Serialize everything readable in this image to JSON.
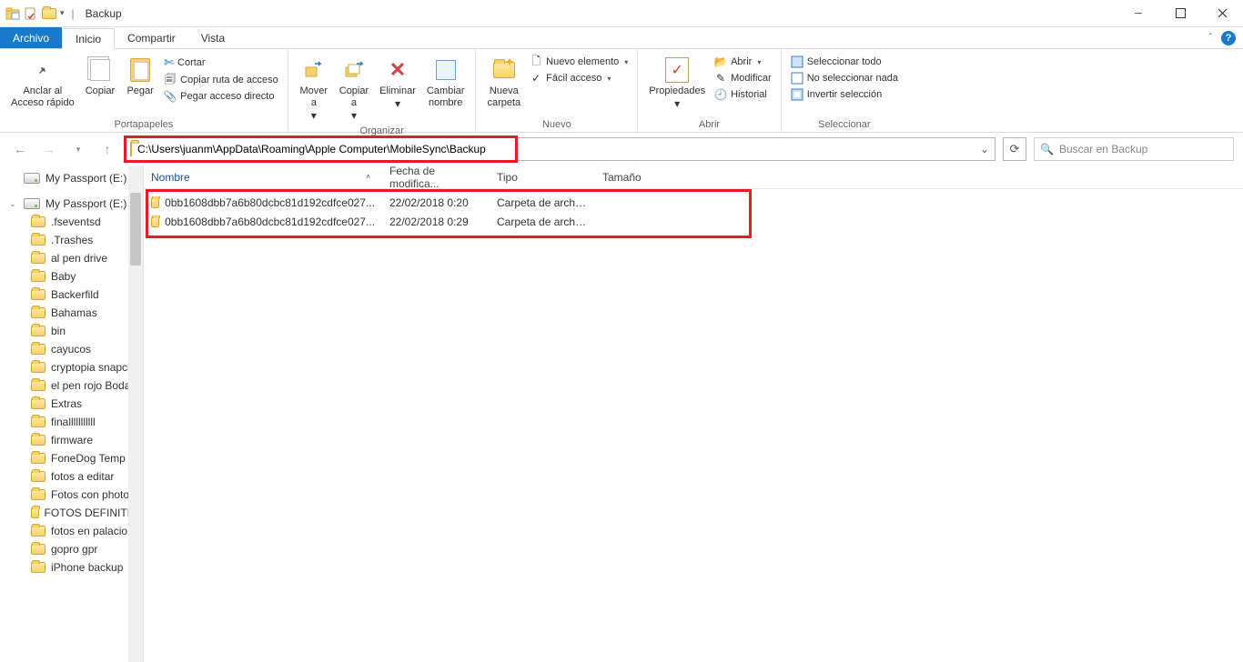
{
  "window": {
    "title": "Backup"
  },
  "tabs": {
    "file": "Archivo",
    "home": "Inicio",
    "share": "Compartir",
    "view": "Vista"
  },
  "ribbon": {
    "clipboard": {
      "pin": "Anclar al\nAcceso rápido",
      "copy": "Copiar",
      "paste": "Pegar",
      "cut": "Cortar",
      "copypath": "Copiar ruta de acceso",
      "pasteshortcut": "Pegar acceso directo",
      "label": "Portapapeles"
    },
    "organize": {
      "moveto": "Mover\na",
      "copyto": "Copiar\na",
      "delete": "Eliminar",
      "rename": "Cambiar\nnombre",
      "label": "Organizar"
    },
    "new": {
      "newfolder": "Nueva\ncarpeta",
      "newitem": "Nuevo elemento",
      "easyaccess": "Fácil acceso",
      "label": "Nuevo"
    },
    "open": {
      "properties": "Propiedades",
      "open": "Abrir",
      "edit": "Modificar",
      "history": "Historial",
      "label": "Abrir"
    },
    "select": {
      "selectall": "Seleccionar todo",
      "selectnone": "No seleccionar nada",
      "invert": "Invertir selección",
      "label": "Seleccionar"
    }
  },
  "address": {
    "path": "C:\\Users\\juanm\\AppData\\Roaming\\Apple Computer\\MobileSync\\Backup"
  },
  "search": {
    "placeholder": "Buscar en Backup"
  },
  "columns": {
    "name": "Nombre",
    "date": "Fecha de modifica...",
    "type": "Tipo",
    "size": "Tamaño"
  },
  "rows": [
    {
      "name": "0bb1608dbb7a6b80dcbc81d192cdfce027...",
      "date": "22/02/2018 0:20",
      "type": "Carpeta de archivos"
    },
    {
      "name": "0bb1608dbb7a6b80dcbc81d192cdfce027...",
      "date": "22/02/2018 0:29",
      "type": "Carpeta de archivos"
    }
  ],
  "sidebar": {
    "drives": [
      "My Passport (E:)",
      "My Passport (E:)"
    ],
    "folders": [
      ".fseventsd",
      ".Trashes",
      "al pen drive",
      "Baby",
      "Backerfild",
      "Bahamas",
      "bin",
      "cayucos",
      "cryptopia snapch",
      "el pen rojo Boda",
      "Extras",
      "finalllllllllll",
      "firmware",
      "FoneDog Temp",
      "fotos a editar",
      "Fotos con photo",
      "FOTOS DEFINITIV",
      "fotos en palacio",
      "gopro gpr",
      "iPhone backup"
    ]
  }
}
